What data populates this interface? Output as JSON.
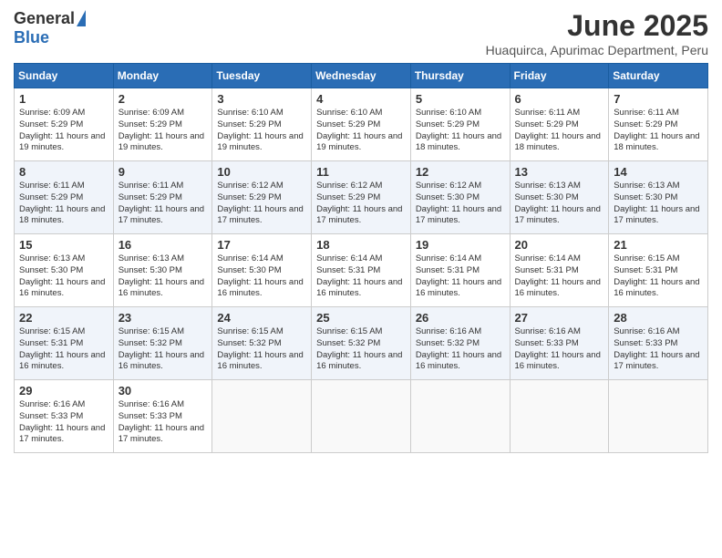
{
  "header": {
    "logo_general": "General",
    "logo_blue": "Blue",
    "title": "June 2025",
    "subtitle": "Huaquirca, Apurimac Department, Peru"
  },
  "days_of_week": [
    "Sunday",
    "Monday",
    "Tuesday",
    "Wednesday",
    "Thursday",
    "Friday",
    "Saturday"
  ],
  "weeks": [
    [
      {
        "day": "1",
        "sunrise": "6:09 AM",
        "sunset": "5:29 PM",
        "daylight": "11 hours and 19 minutes."
      },
      {
        "day": "2",
        "sunrise": "6:09 AM",
        "sunset": "5:29 PM",
        "daylight": "11 hours and 19 minutes."
      },
      {
        "day": "3",
        "sunrise": "6:10 AM",
        "sunset": "5:29 PM",
        "daylight": "11 hours and 19 minutes."
      },
      {
        "day": "4",
        "sunrise": "6:10 AM",
        "sunset": "5:29 PM",
        "daylight": "11 hours and 19 minutes."
      },
      {
        "day": "5",
        "sunrise": "6:10 AM",
        "sunset": "5:29 PM",
        "daylight": "11 hours and 18 minutes."
      },
      {
        "day": "6",
        "sunrise": "6:11 AM",
        "sunset": "5:29 PM",
        "daylight": "11 hours and 18 minutes."
      },
      {
        "day": "7",
        "sunrise": "6:11 AM",
        "sunset": "5:29 PM",
        "daylight": "11 hours and 18 minutes."
      }
    ],
    [
      {
        "day": "8",
        "sunrise": "6:11 AM",
        "sunset": "5:29 PM",
        "daylight": "11 hours and 18 minutes."
      },
      {
        "day": "9",
        "sunrise": "6:11 AM",
        "sunset": "5:29 PM",
        "daylight": "11 hours and 17 minutes."
      },
      {
        "day": "10",
        "sunrise": "6:12 AM",
        "sunset": "5:29 PM",
        "daylight": "11 hours and 17 minutes."
      },
      {
        "day": "11",
        "sunrise": "6:12 AM",
        "sunset": "5:29 PM",
        "daylight": "11 hours and 17 minutes."
      },
      {
        "day": "12",
        "sunrise": "6:12 AM",
        "sunset": "5:30 PM",
        "daylight": "11 hours and 17 minutes."
      },
      {
        "day": "13",
        "sunrise": "6:13 AM",
        "sunset": "5:30 PM",
        "daylight": "11 hours and 17 minutes."
      },
      {
        "day": "14",
        "sunrise": "6:13 AM",
        "sunset": "5:30 PM",
        "daylight": "11 hours and 17 minutes."
      }
    ],
    [
      {
        "day": "15",
        "sunrise": "6:13 AM",
        "sunset": "5:30 PM",
        "daylight": "11 hours and 16 minutes."
      },
      {
        "day": "16",
        "sunrise": "6:13 AM",
        "sunset": "5:30 PM",
        "daylight": "11 hours and 16 minutes."
      },
      {
        "day": "17",
        "sunrise": "6:14 AM",
        "sunset": "5:30 PM",
        "daylight": "11 hours and 16 minutes."
      },
      {
        "day": "18",
        "sunrise": "6:14 AM",
        "sunset": "5:31 PM",
        "daylight": "11 hours and 16 minutes."
      },
      {
        "day": "19",
        "sunrise": "6:14 AM",
        "sunset": "5:31 PM",
        "daylight": "11 hours and 16 minutes."
      },
      {
        "day": "20",
        "sunrise": "6:14 AM",
        "sunset": "5:31 PM",
        "daylight": "11 hours and 16 minutes."
      },
      {
        "day": "21",
        "sunrise": "6:15 AM",
        "sunset": "5:31 PM",
        "daylight": "11 hours and 16 minutes."
      }
    ],
    [
      {
        "day": "22",
        "sunrise": "6:15 AM",
        "sunset": "5:31 PM",
        "daylight": "11 hours and 16 minutes."
      },
      {
        "day": "23",
        "sunrise": "6:15 AM",
        "sunset": "5:32 PM",
        "daylight": "11 hours and 16 minutes."
      },
      {
        "day": "24",
        "sunrise": "6:15 AM",
        "sunset": "5:32 PM",
        "daylight": "11 hours and 16 minutes."
      },
      {
        "day": "25",
        "sunrise": "6:15 AM",
        "sunset": "5:32 PM",
        "daylight": "11 hours and 16 minutes."
      },
      {
        "day": "26",
        "sunrise": "6:16 AM",
        "sunset": "5:32 PM",
        "daylight": "11 hours and 16 minutes."
      },
      {
        "day": "27",
        "sunrise": "6:16 AM",
        "sunset": "5:33 PM",
        "daylight": "11 hours and 16 minutes."
      },
      {
        "day": "28",
        "sunrise": "6:16 AM",
        "sunset": "5:33 PM",
        "daylight": "11 hours and 17 minutes."
      }
    ],
    [
      {
        "day": "29",
        "sunrise": "6:16 AM",
        "sunset": "5:33 PM",
        "daylight": "11 hours and 17 minutes."
      },
      {
        "day": "30",
        "sunrise": "6:16 AM",
        "sunset": "5:33 PM",
        "daylight": "11 hours and 17 minutes."
      },
      {
        "day": "",
        "sunrise": "",
        "sunset": "",
        "daylight": ""
      },
      {
        "day": "",
        "sunrise": "",
        "sunset": "",
        "daylight": ""
      },
      {
        "day": "",
        "sunrise": "",
        "sunset": "",
        "daylight": ""
      },
      {
        "day": "",
        "sunrise": "",
        "sunset": "",
        "daylight": ""
      },
      {
        "day": "",
        "sunrise": "",
        "sunset": "",
        "daylight": ""
      }
    ]
  ],
  "labels": {
    "sunrise": "Sunrise: ",
    "sunset": "Sunset: ",
    "daylight": "Daylight: "
  }
}
